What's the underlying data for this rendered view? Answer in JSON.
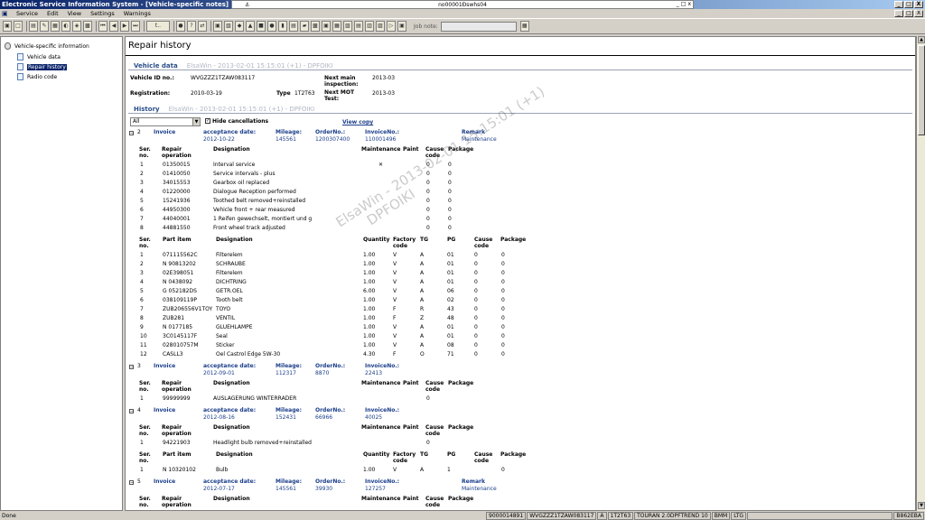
{
  "window": {
    "title": "Electronic Service Information System - [Vehicle-specific notes]",
    "ie_title": "no00001Ðswhs04",
    "ie_icon": "⚓",
    "win_min": "_",
    "win_max": "□",
    "win_close": "X",
    "ie_min": "_",
    "ie_max": "□",
    "ie_close": "x",
    "mdi_min": "_",
    "mdi_max": "□",
    "mdi_close": "X"
  },
  "menu": {
    "items": [
      "Service",
      "Edit",
      "View",
      "Settings",
      "Warnings"
    ]
  },
  "toolbar": {
    "button_glyphs": [
      "▣",
      "□",
      "▤",
      "✎",
      "▦",
      "◐",
      "◈",
      "▩",
      "⏮",
      "◀",
      "▶",
      "⏭",
      "t..",
      "●",
      "?",
      "⇄",
      "▣",
      "▧",
      "◆",
      "▲",
      "■",
      "●",
      "▮",
      "▤",
      "▰",
      "▩",
      "▣",
      "▦",
      "▧",
      "▤",
      "▥",
      "▨",
      "▷",
      "▣"
    ],
    "job_note_label": "Job note:",
    "job_note_value": "",
    "job_button_glyph": "▦"
  },
  "sidebar": {
    "root": "Vehicle-specific information",
    "items": [
      {
        "label": "Vehicle data",
        "selected": false
      },
      {
        "label": "Repair history",
        "selected": true
      },
      {
        "label": "Radio code",
        "selected": false
      }
    ]
  },
  "page": {
    "title": "Repair history",
    "vehicle_data": {
      "section_label": "Vehicle data",
      "stamp": "ElsaWin - 2013-02-01 15:15:01 (+1) - DPFOIKI",
      "vehicle_id_label": "Vehicle ID no.:",
      "vehicle_id": "WVGZZZ1TZAW083117",
      "next_main_label": "Next main inspection:",
      "next_main": "2013-03",
      "registration_label": "Registration:",
      "registration": "2010-03-19",
      "type_label": "Type",
      "type": "1T2T63",
      "next_mot_label": "Next MOT Test:",
      "next_mot": "2013-03"
    },
    "history": {
      "section_label": "History",
      "stamp": "ElsaWin - 2013-02-01 15:15:01 (+1) - DPFOIKI",
      "filter": "All",
      "filter_arrow": "▼",
      "hide_checked": "✓",
      "hide_cancellations": "Hide cancellations",
      "view_copy": "View copy"
    },
    "watermark_line1": "ElsaWin - 2013-02-01 15:15:01 (+1)",
    "watermark_line2": "DPFOIKI"
  },
  "labels": {
    "invoice": "Invoice",
    "acceptance_date": "acceptance date:",
    "mileage": "Mileage:",
    "order_no": "OrderNo.:",
    "invoice_no": "InvoiceNo.:",
    "remark": "Remark",
    "ser_no": "Ser. no.",
    "repair_operation": "Repair operation",
    "designation": "Designation",
    "maintenance": "Maintenance",
    "paint": "Paint",
    "cause_code": "Cause code",
    "package": "Package",
    "part_item": "Part item",
    "quantity": "Quantity",
    "factory_code": "Factory code",
    "tg": "TG",
    "pg": "PG",
    "collapse": "−"
  },
  "invoices": [
    {
      "num": "2",
      "date": "2012-10-22",
      "mileage": "145561",
      "order": "1200307400",
      "invoice_no": "110001496",
      "remark": "Maintenance",
      "ops": [
        {
          "ser": "1",
          "op": "01350015",
          "des": "Interval service",
          "maint": "✕",
          "cause": "0",
          "pkg": "0"
        },
        {
          "ser": "2",
          "op": "01410050",
          "des": "Service intervals - plus",
          "maint": "",
          "cause": "0",
          "pkg": "0"
        },
        {
          "ser": "3",
          "op": "34015553",
          "des": "Gearbox oil replaced",
          "maint": "",
          "cause": "0",
          "pkg": "0"
        },
        {
          "ser": "4",
          "op": "01220000",
          "des": "Dialogue Reception performed",
          "maint": "",
          "cause": "0",
          "pkg": "0"
        },
        {
          "ser": "5",
          "op": "15241936",
          "des": "Toothed belt removed+reinstalled",
          "maint": "",
          "cause": "0",
          "pkg": "0"
        },
        {
          "ser": "6",
          "op": "44950300",
          "des": "Vehicle front + rear measured",
          "maint": "",
          "cause": "0",
          "pkg": "0"
        },
        {
          "ser": "7",
          "op": "44040001",
          "des": "1 Reifen gewechselt, montiert und g",
          "maint": "",
          "cause": "0",
          "pkg": "0"
        },
        {
          "ser": "8",
          "op": "44881550",
          "des": "Front wheel track adjusted",
          "maint": "",
          "cause": "0",
          "pkg": "0"
        }
      ],
      "parts": [
        {
          "ser": "1",
          "part": "071115562C",
          "des": "Filterelem",
          "qty": "1.00",
          "fc": "V",
          "tg": "A",
          "pg": "01",
          "cause": "0",
          "pkg": "0"
        },
        {
          "ser": "2",
          "part": "N 90813202",
          "des": "SCHRAUBE",
          "qty": "1.00",
          "fc": "V",
          "tg": "A",
          "pg": "01",
          "cause": "0",
          "pkg": "0"
        },
        {
          "ser": "3",
          "part": "02E398051",
          "des": "Filterelem",
          "qty": "1.00",
          "fc": "V",
          "tg": "A",
          "pg": "01",
          "cause": "0",
          "pkg": "0"
        },
        {
          "ser": "4",
          "part": "N 0438092",
          "des": "DICHTRING",
          "qty": "1.00",
          "fc": "V",
          "tg": "A",
          "pg": "01",
          "cause": "0",
          "pkg": "0"
        },
        {
          "ser": "5",
          "part": "G 052182DS",
          "des": "GETR.OEL",
          "qty": "6.00",
          "fc": "V",
          "tg": "A",
          "pg": "06",
          "cause": "0",
          "pkg": "0"
        },
        {
          "ser": "6",
          "part": "038109119P",
          "des": "Tooth belt",
          "qty": "1.00",
          "fc": "V",
          "tg": "A",
          "pg": "02",
          "cause": "0",
          "pkg": "0"
        },
        {
          "ser": "7",
          "part": "ZUB206556V1TOY",
          "des": "TOYO",
          "qty": "1.00",
          "fc": "F",
          "tg": "R",
          "pg": "43",
          "cause": "0",
          "pkg": "0"
        },
        {
          "ser": "8",
          "part": "ZUB281",
          "des": "VENTIL",
          "qty": "1.00",
          "fc": "F",
          "tg": "Z",
          "pg": "48",
          "cause": "0",
          "pkg": "0"
        },
        {
          "ser": "9",
          "part": "N 0177185",
          "des": "GLUEHLAMPE",
          "qty": "1.00",
          "fc": "V",
          "tg": "A",
          "pg": "01",
          "cause": "0",
          "pkg": "0"
        },
        {
          "ser": "10",
          "part": "3C0145117F",
          "des": "Seal",
          "qty": "1.00",
          "fc": "V",
          "tg": "A",
          "pg": "01",
          "cause": "0",
          "pkg": "0"
        },
        {
          "ser": "11",
          "part": "028010757M",
          "des": "Sticker",
          "qty": "1.00",
          "fc": "V",
          "tg": "A",
          "pg": "08",
          "cause": "0",
          "pkg": "0"
        },
        {
          "ser": "12",
          "part": "CASLL3",
          "des": "Oel Castrol Edge 5W-30",
          "qty": "4.30",
          "fc": "F",
          "tg": "O",
          "pg": "71",
          "cause": "0",
          "pkg": "0"
        }
      ]
    },
    {
      "num": "3",
      "date": "2012-09-01",
      "mileage": "112317",
      "order": "8870",
      "invoice_no": "22413",
      "remark": "",
      "ops": [
        {
          "ser": "1",
          "op": "99999999",
          "des": "AUSLAGERUNG WINTERRADER",
          "maint": "",
          "cause": "0",
          "pkg": ""
        }
      ],
      "parts": []
    },
    {
      "num": "4",
      "date": "2012-08-16",
      "mileage": "152431",
      "order": "66966",
      "invoice_no": "40025",
      "remark": "",
      "ops": [
        {
          "ser": "1",
          "op": "94221903",
          "des": "Headlight bulb removed+reinstalled",
          "maint": "",
          "cause": "0",
          "pkg": ""
        }
      ],
      "parts": [
        {
          "ser": "1",
          "part": "N 10320102",
          "des": "Bulb",
          "qty": "1.00",
          "fc": "V",
          "tg": "A",
          "pg": "1",
          "cause": "",
          "pkg": "0"
        }
      ]
    },
    {
      "num": "5",
      "date": "2012-07-17",
      "mileage": "145561",
      "order": "39930",
      "invoice_no": "127257",
      "remark": "Maintenance",
      "ops": [],
      "parts": []
    }
  ],
  "status": {
    "done": "Done",
    "cells": [
      "9000014891",
      "WVGZZZ1TZAW083117",
      "A",
      "1T2T63",
      "TOURAN 2.0DPFTREND 10",
      "BMM",
      "LTG",
      "",
      "B862EBA"
    ]
  },
  "scroll": {
    "up": "▲",
    "down": "▼"
  }
}
